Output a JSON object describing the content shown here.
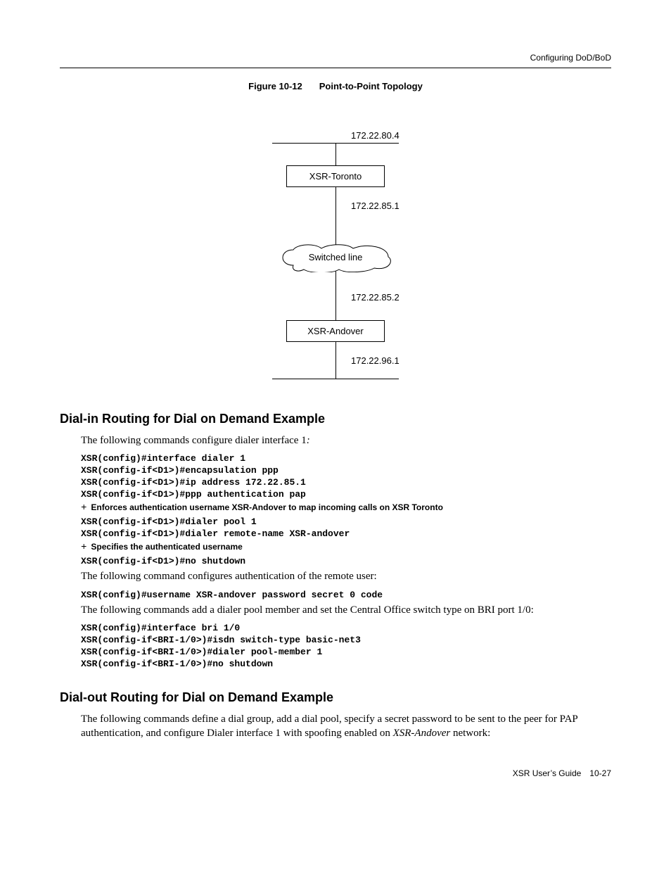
{
  "header": {
    "section": "Configuring DoD/BoD"
  },
  "figure": {
    "label": "Figure 10-12",
    "title": "Point-to-Point Topology",
    "ip_top": "172.22.80.4",
    "node_top": "XSR-Toronto",
    "ip_mid_top": "172.22.85.1",
    "cloud": "Switched line",
    "ip_mid_bottom": "172.22.85.2",
    "node_bottom": "XSR-Andover",
    "ip_bottom": "172.22.96.1"
  },
  "sections": {
    "dialin": {
      "title": "Dial-in Routing for Dial on Demand Example",
      "intro_pre": "The following commands configure dialer interface 1",
      "intro_suffix": ":",
      "code1": [
        "XSR(config)#interface dialer 1",
        "XSR(config-if<D1>)#encapsulation ppp",
        "XSR(config-if<D1>)#ip address 172.22.85.1",
        "XSR(config-if<D1>)#ppp authentication pap"
      ],
      "note1": "Enforces authentication username XSR-Andover to map incoming calls on XSR Toronto",
      "code2": [
        "XSR(config-if<D1>)#dialer pool 1",
        "XSR(config-if<D1>)#dialer remote-name XSR-andover"
      ],
      "note2": "Specifies the authenticated username",
      "code3": [
        "XSR(config-if<D1>)#no shutdown"
      ],
      "para2": "The following command configures authentication of the remote user:",
      "code4": [
        "XSR(config)#username XSR-andover password secret 0 code"
      ],
      "para3": "The following commands add a dialer pool member and set the Central Office switch type on BRI port 1/0:",
      "code5": [
        "XSR(config)#interface bri 1/0",
        "XSR(config-if<BRI-1/0>)#isdn switch-type basic-net3",
        "XSR(config-if<BRI-1/0>)#dialer pool-member 1",
        "XSR(config-if<BRI-1/0>)#no shutdown"
      ]
    },
    "dialout": {
      "title": "Dial-out Routing for Dial on Demand Example",
      "para_pre": "The following commands define a dial group, add a dial pool, specify a secret password to be sent to the peer for PAP authentication, and configure Dialer interface 1 with spoofing enabled on ",
      "para_em": "XSR-Andover",
      "para_post": " network:"
    }
  },
  "footer": {
    "guide": "XSR User’s Guide",
    "page": "10-27"
  }
}
